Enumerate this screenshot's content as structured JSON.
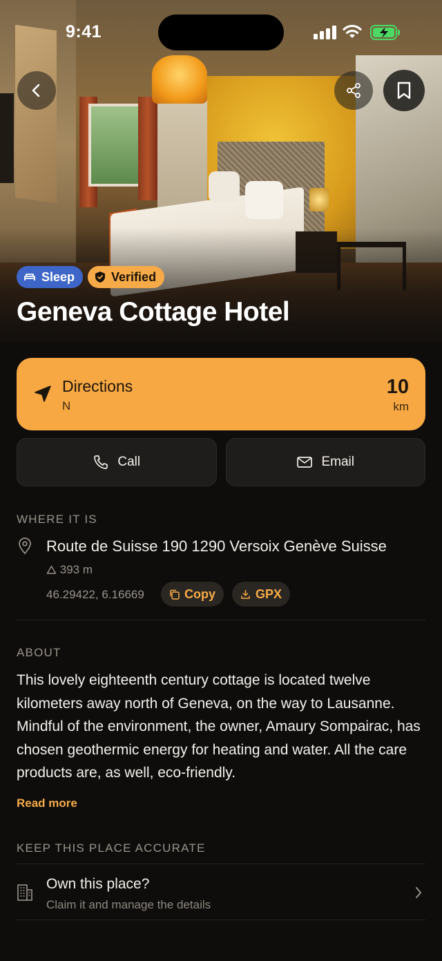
{
  "status_bar": {
    "time": "9:41"
  },
  "place": {
    "name": "Geneva Cottage Hotel",
    "badges": [
      {
        "label": "Sleep",
        "icon": "bed-icon",
        "color": "#3e66c8"
      },
      {
        "label": "Verified",
        "icon": "shield-check-icon",
        "color": "#f7ab48"
      }
    ]
  },
  "directions": {
    "label": "Directions",
    "heading": "N",
    "distance": "10",
    "unit": "km"
  },
  "actions": {
    "call_label": "Call",
    "email_label": "Email"
  },
  "location": {
    "section_title": "WHERE IT IS",
    "address": "Route de Suisse 190 1290 Versoix Genève Suisse",
    "elevation": "393 m",
    "coordinates": "46.29422, 6.16669",
    "copy_label": "Copy",
    "gpx_label": "GPX"
  },
  "about": {
    "section_title": "ABOUT",
    "text": "This lovely eighteenth century cottage is located twelve kilometers away north of Geneva, on the way to Lausanne. Mindful of the environment, the owner, Amaury Sompairac, has chosen geothermic energy for heating and water. All the care products are, as well, eco-friendly.",
    "read_more": "Read more"
  },
  "accuracy": {
    "section_title": "KEEP THIS PLACE ACCURATE",
    "claim_title": "Own this place?",
    "claim_subtitle": "Claim it and manage the details"
  },
  "colors": {
    "accent": "#f8a843",
    "background": "#0e0d0c",
    "card": "#1f1d1b"
  }
}
